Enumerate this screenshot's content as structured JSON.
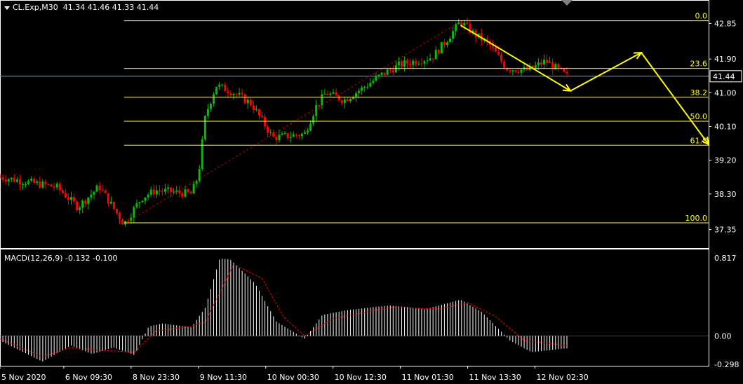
{
  "header": {
    "symbol": "CL.Exp,M30",
    "ohlc": "41.34 41.46 41.33 41.44"
  },
  "macd": {
    "title": "MACD(12,26,9) -0.132 -0.100",
    "axis_labels": [
      "0.817",
      "0.00",
      "-0.298"
    ],
    "range": [
      -0.298,
      0.817
    ]
  },
  "colors": {
    "background": "#000000",
    "bull": "#00c000",
    "bear": "#ff0000",
    "fib": "#ffff00",
    "trend": "#c00000",
    "arrow": "#ffff00",
    "macd_hist": "#ffffff",
    "signal": "#ff0000",
    "axis": "#ffffff",
    "price_tag_bg": "#000000"
  },
  "chart_data": {
    "type": "candlestick",
    "symbol": "CL.Exp",
    "timeframe": "M30",
    "ylim": [
      37.1,
      43.1
    ],
    "y_ticks": [
      "42.85",
      "41.90",
      "41.00",
      "40.10",
      "39.20",
      "38.30",
      "37.35"
    ],
    "current_price": "41.44",
    "x_ticks": [
      "5 Nov 2020",
      "6 Nov 09:30",
      "8 Nov 23:30",
      "9 Nov 11:30",
      "10 Nov 00:30",
      "10 Nov 12:30",
      "11 Nov 01:30",
      "11 Nov 13:30",
      "12 Nov 02:30"
    ],
    "fib_levels": [
      {
        "label": "0.0",
        "price": 42.92
      },
      {
        "label": "23.6",
        "price": 41.65
      },
      {
        "label": "38.2",
        "price": 40.88
      },
      {
        "label": "50.0",
        "price": 40.24
      },
      {
        "label": "61.8",
        "price": 39.6
      },
      {
        "label": "100.0",
        "price": 37.53
      }
    ],
    "key_points": [
      {
        "x": 0.0,
        "price": 38.75
      },
      {
        "x": 0.08,
        "price": 38.48
      },
      {
        "x": 0.11,
        "price": 37.95
      },
      {
        "x": 0.14,
        "price": 38.5
      },
      {
        "x": 0.175,
        "price": 37.5
      },
      {
        "x": 0.2,
        "price": 38.2
      },
      {
        "x": 0.22,
        "price": 38.4
      },
      {
        "x": 0.27,
        "price": 38.3
      },
      {
        "x": 0.28,
        "price": 38.8
      },
      {
        "x": 0.29,
        "price": 40.4
      },
      {
        "x": 0.305,
        "price": 41.2
      },
      {
        "x": 0.33,
        "price": 41.0
      },
      {
        "x": 0.355,
        "price": 40.7
      },
      {
        "x": 0.385,
        "price": 39.8
      },
      {
        "x": 0.43,
        "price": 39.9
      },
      {
        "x": 0.445,
        "price": 40.6
      },
      {
        "x": 0.46,
        "price": 41.0
      },
      {
        "x": 0.485,
        "price": 40.8
      },
      {
        "x": 0.51,
        "price": 41.1
      },
      {
        "x": 0.54,
        "price": 41.5
      },
      {
        "x": 0.565,
        "price": 41.75
      },
      {
        "x": 0.61,
        "price": 41.95
      },
      {
        "x": 0.63,
        "price": 42.4
      },
      {
        "x": 0.65,
        "price": 42.9
      },
      {
        "x": 0.67,
        "price": 42.55
      },
      {
        "x": 0.69,
        "price": 42.3
      },
      {
        "x": 0.715,
        "price": 41.65
      },
      {
        "x": 0.745,
        "price": 41.6
      },
      {
        "x": 0.77,
        "price": 41.85
      },
      {
        "x": 0.8,
        "price": 41.44
      }
    ],
    "trend_line": [
      {
        "x": 0.175,
        "price": 37.5
      },
      {
        "x": 0.65,
        "price": 42.9
      }
    ],
    "forecast_arrows": [
      [
        {
          "x": 0.65,
          "price": 42.8
        },
        {
          "x": 0.805,
          "price": 41.05
        }
      ],
      [
        {
          "x": 0.805,
          "price": 41.05
        },
        {
          "x": 0.905,
          "price": 42.07
        }
      ],
      [
        {
          "x": 0.905,
          "price": 42.07
        },
        {
          "x": 1.0,
          "price": 39.62
        }
      ]
    ],
    "macd": {
      "name": "MACD(12,26,9)",
      "main": -0.132,
      "signal": -0.1,
      "ylim": [
        -0.298,
        0.817
      ],
      "key_points": [
        {
          "x": 0.0,
          "price": -0.05
        },
        {
          "x": 0.06,
          "price": -0.27
        },
        {
          "x": 0.1,
          "price": -0.1
        },
        {
          "x": 0.13,
          "price": -0.19
        },
        {
          "x": 0.16,
          "price": -0.12
        },
        {
          "x": 0.19,
          "price": -0.2
        },
        {
          "x": 0.21,
          "price": 0.1
        },
        {
          "x": 0.23,
          "price": 0.13
        },
        {
          "x": 0.27,
          "price": 0.09
        },
        {
          "x": 0.29,
          "price": 0.3
        },
        {
          "x": 0.31,
          "price": 0.81
        },
        {
          "x": 0.325,
          "price": 0.8
        },
        {
          "x": 0.36,
          "price": 0.55
        },
        {
          "x": 0.39,
          "price": 0.15
        },
        {
          "x": 0.43,
          "price": -0.03
        },
        {
          "x": 0.455,
          "price": 0.22
        },
        {
          "x": 0.49,
          "price": 0.27
        },
        {
          "x": 0.55,
          "price": 0.32
        },
        {
          "x": 0.6,
          "price": 0.28
        },
        {
          "x": 0.65,
          "price": 0.38
        },
        {
          "x": 0.68,
          "price": 0.25
        },
        {
          "x": 0.72,
          "price": -0.05
        },
        {
          "x": 0.75,
          "price": -0.17
        },
        {
          "x": 0.8,
          "price": -0.13
        }
      ],
      "signal_points": [
        {
          "x": 0.0,
          "price": -0.03
        },
        {
          "x": 0.06,
          "price": -0.22
        },
        {
          "x": 0.1,
          "price": -0.12
        },
        {
          "x": 0.14,
          "price": -0.15
        },
        {
          "x": 0.19,
          "price": -0.17
        },
        {
          "x": 0.22,
          "price": 0.05
        },
        {
          "x": 0.27,
          "price": 0.1
        },
        {
          "x": 0.29,
          "price": 0.15
        },
        {
          "x": 0.33,
          "price": 0.75
        },
        {
          "x": 0.37,
          "price": 0.6
        },
        {
          "x": 0.4,
          "price": 0.2
        },
        {
          "x": 0.43,
          "price": 0.0
        },
        {
          "x": 0.47,
          "price": 0.18
        },
        {
          "x": 0.55,
          "price": 0.3
        },
        {
          "x": 0.62,
          "price": 0.28
        },
        {
          "x": 0.66,
          "price": 0.35
        },
        {
          "x": 0.7,
          "price": 0.2
        },
        {
          "x": 0.74,
          "price": -0.05
        },
        {
          "x": 0.8,
          "price": -0.1
        }
      ]
    }
  }
}
